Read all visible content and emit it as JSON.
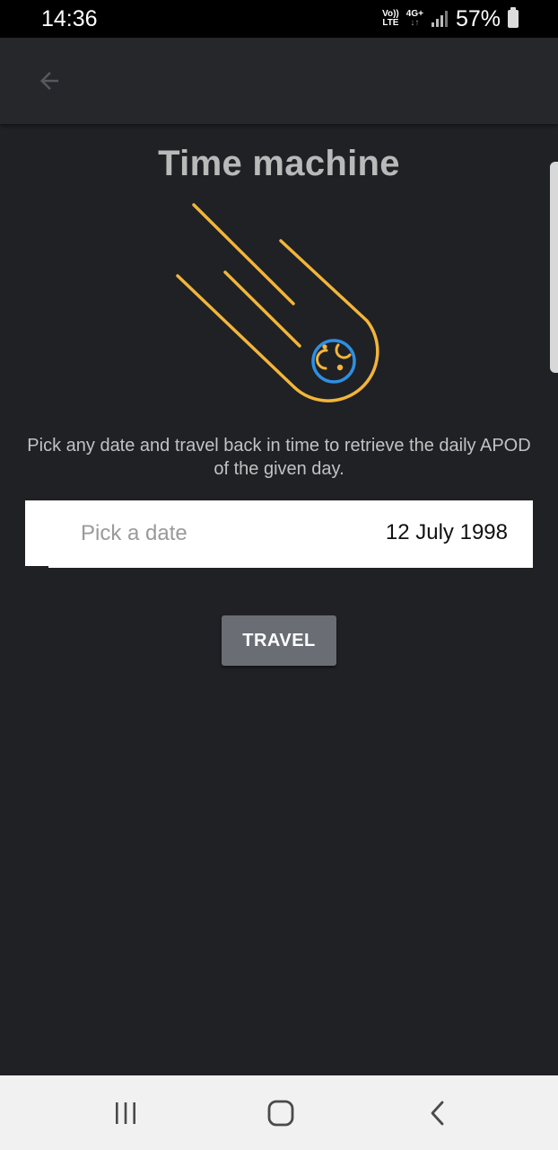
{
  "status_bar": {
    "time": "14:36",
    "volte_top": "Vo))",
    "volte_bottom": "LTE",
    "network_type": "4G+",
    "network_arrows": "↓↑",
    "battery_percent": "57%",
    "icons": [
      "signal-icon",
      "battery-icon"
    ]
  },
  "app_bar": {
    "back_icon": "arrow-left-icon"
  },
  "main": {
    "title": "Time machine",
    "illustration": "comet-icon",
    "description": "Pick any date and travel back in time to retrieve the daily APOD of the given day.",
    "date_field": {
      "placeholder": "Pick a date",
      "value": "12 July 1998"
    },
    "travel_button_label": "TRAVEL"
  },
  "nav_bar": {
    "items": [
      "recents-icon",
      "home-icon",
      "back-icon"
    ]
  },
  "colors": {
    "background": "#1f2125",
    "app_bar": "#25272b",
    "comet_orange": "#f2b53a",
    "planet_blue": "#2f8fe0",
    "button": "#6a6d73",
    "nav_bar": "#f1f1f1"
  }
}
